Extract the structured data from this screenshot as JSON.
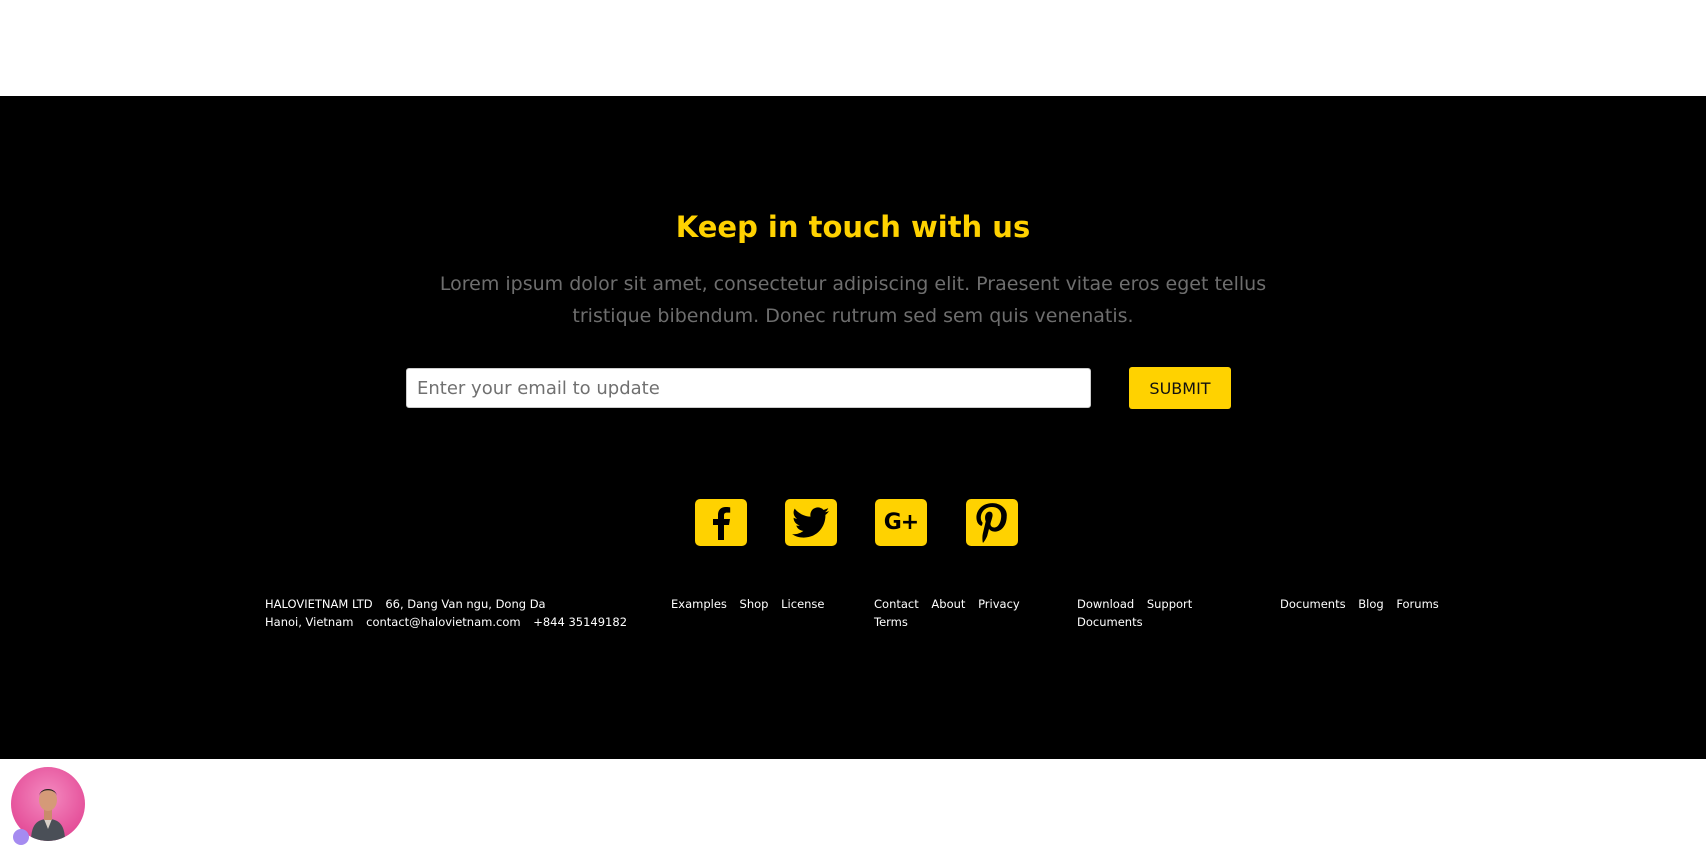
{
  "newsletter": {
    "heading": "Keep in touch with us",
    "description": "Lorem ipsum dolor sit amet, consectetur adipiscing elit. Praesent vitae eros eget tellus tristique bibendum. Donec rutrum sed sem quis venenatis.",
    "email_placeholder": "Enter your email to update",
    "submit_label": "SUBMIT"
  },
  "social": [
    {
      "name": "facebook-icon"
    },
    {
      "name": "twitter-icon"
    },
    {
      "name": "google-plus-icon",
      "label": "G+"
    },
    {
      "name": "pinterest-icon"
    }
  ],
  "company": {
    "name": "HALOVIETNAM LTD",
    "address_line1": "66, Dang Van ngu, Dong Da",
    "address_line2": "Hanoi, Vietnam",
    "email": "contact@halovietnam.com",
    "phone": "+844 35149182"
  },
  "link_groups": [
    [
      "Examples",
      "Shop",
      "License"
    ],
    [
      "Contact",
      "About",
      "Privacy",
      "Terms"
    ],
    [
      "Download",
      "Support",
      "Documents"
    ],
    [
      "Documents",
      "Blog",
      "Forums"
    ]
  ],
  "colors": {
    "accent": "#ffd200",
    "background": "#000000",
    "muted_text": "#6e6e6e"
  }
}
